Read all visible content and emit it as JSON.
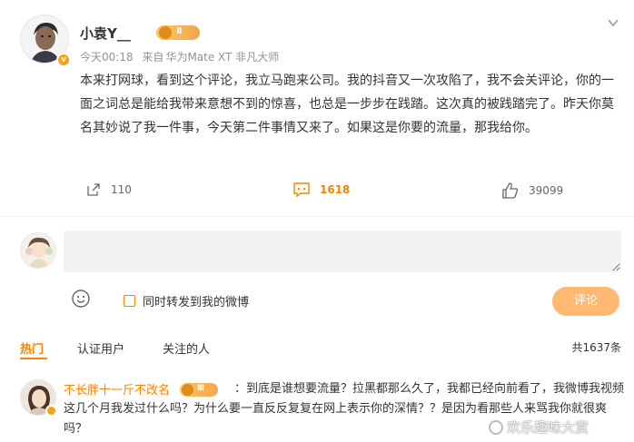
{
  "post": {
    "username": "小袁Y__",
    "level": "II",
    "time": "今天00:18",
    "source_prefix": "来自",
    "source": "华为Mate XT 非凡大师",
    "body": "本来打网球，看到这个评论，我立马跑来公司。我的抖音又一次攻陷了，我不会关评论，你的一面之词总是能给我带来意想不到的惊喜，也总是一步步在践踏。这次真的被践踏完了。昨天你莫名其妙说了我一件事，今天第二件事情又来了。如果这是你要的流量，那我给你。"
  },
  "actions": {
    "repost_count": "110",
    "comment_count": "1618",
    "like_count": "39099"
  },
  "composer": {
    "placeholder": "",
    "repost_label": "同时转发到我的微博",
    "submit_label": "评论"
  },
  "comment_tabs": [
    {
      "label": "热门"
    },
    {
      "label": "认证用户"
    },
    {
      "label": "关注的人"
    }
  ],
  "total_comments": "共1637条",
  "top_comment": {
    "username": "不长胖十一斤不改名",
    "level": "III",
    "text_line1": "：到底是谁想要流量？拉黑都那么久了，我都已经向前看了，我微博我视频",
    "text_rest": "这几个月我发过什么吗？为什么要一直反反复复在网上表示你的深情？？是因为看那些人来骂我你就很爽吗？"
  },
  "watermark": "欢乐趣味大赏",
  "colors": {
    "accent": "#ff8200",
    "button_disabled": "#ffb973",
    "meta_gray": "#939393"
  }
}
